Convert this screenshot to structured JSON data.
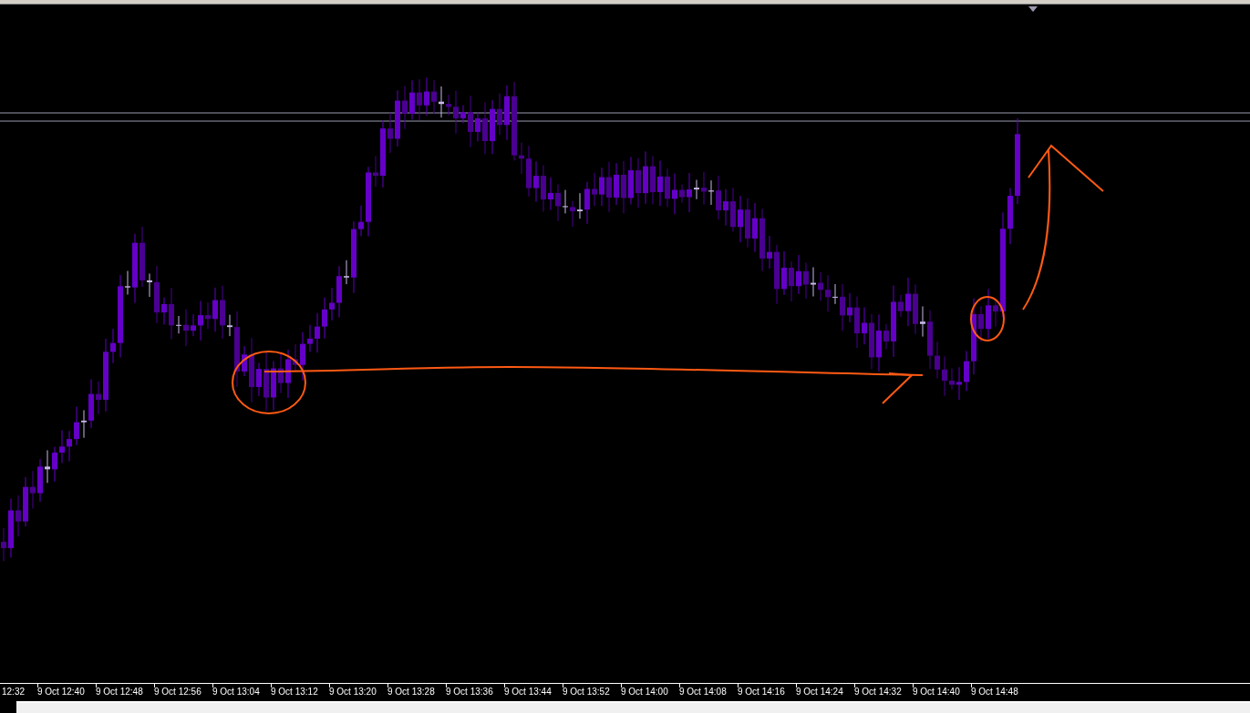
{
  "time_axis": {
    "labels": [
      "12:32",
      "9 Oct 12:40",
      "9 Oct 12:48",
      "9 Oct 12:56",
      "9 Oct 13:04",
      "9 Oct 13:12",
      "9 Oct 13:20",
      "9 Oct 13:28",
      "9 Oct 13:36",
      "9 Oct 13:44",
      "9 Oct 13:52",
      "9 Oct 14:00",
      "9 Oct 14:08",
      "9 Oct 14:16",
      "9 Oct 14:24",
      "9 Oct 14:32",
      "9 Oct 14:40",
      "9 Oct 14:48"
    ]
  }
}
